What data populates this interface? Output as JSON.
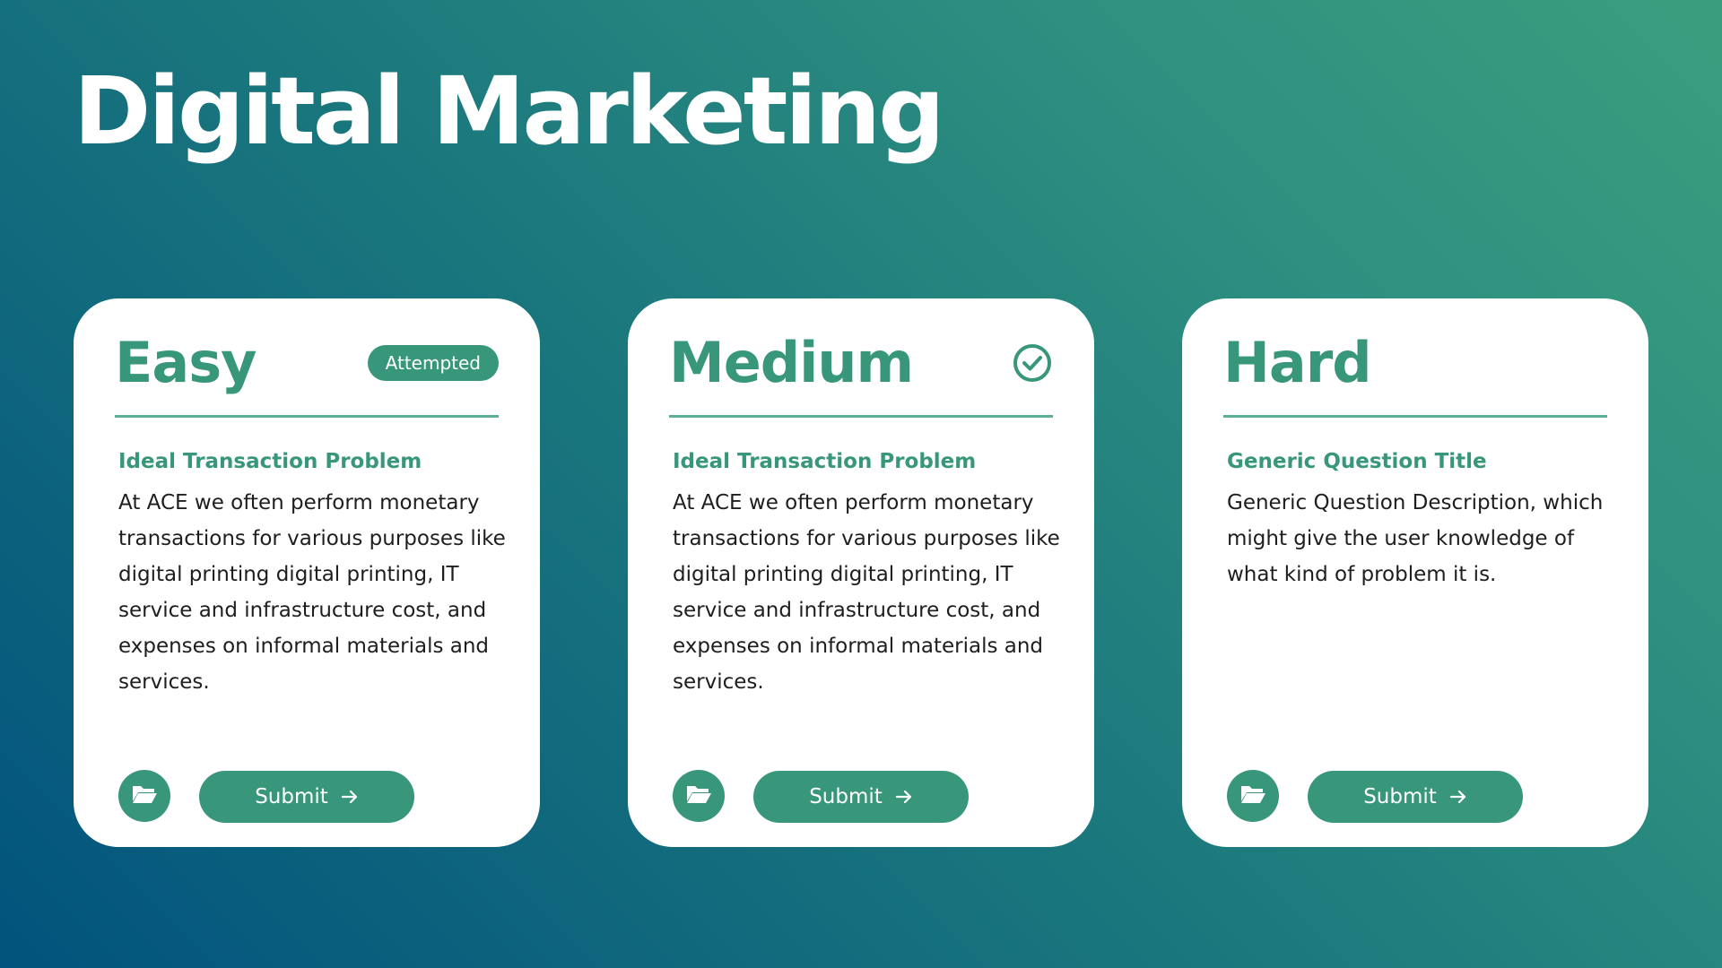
{
  "page": {
    "title": "Digital Marketing"
  },
  "colors": {
    "accent": "#38977b",
    "card_bg": "#ffffff",
    "bg_start": "#02537d",
    "bg_end": "#3a9e7e"
  },
  "cards": [
    {
      "level": "Easy",
      "status_badge": "Attempted",
      "question_title": "Ideal Transaction Problem",
      "question_desc": "At ACE we often perform monetary transactions for various purposes like digital printing digital printing, IT service and infrastructure cost, and expenses on informal materials and services.",
      "folder_icon": "folder-open-icon",
      "submit_label": "Submit",
      "submit_icon": "arrow-right-icon"
    },
    {
      "level": "Medium",
      "status_icon": "check-circle-icon",
      "question_title": "Ideal Transaction Problem",
      "question_desc": "At ACE we often perform monetary transactions for various purposes like digital printing digital printing, IT service and infrastructure cost, and expenses on informal materials and services.",
      "folder_icon": "folder-open-icon",
      "submit_label": "Submit",
      "submit_icon": "arrow-right-icon"
    },
    {
      "level": "Hard",
      "question_title": "Generic Question Title",
      "question_desc": "Generic Question Description, which might give the user knowledge of what kind of problem it is.",
      "folder_icon": "folder-open-icon",
      "submit_label": "Submit",
      "submit_icon": "arrow-right-icon"
    }
  ]
}
